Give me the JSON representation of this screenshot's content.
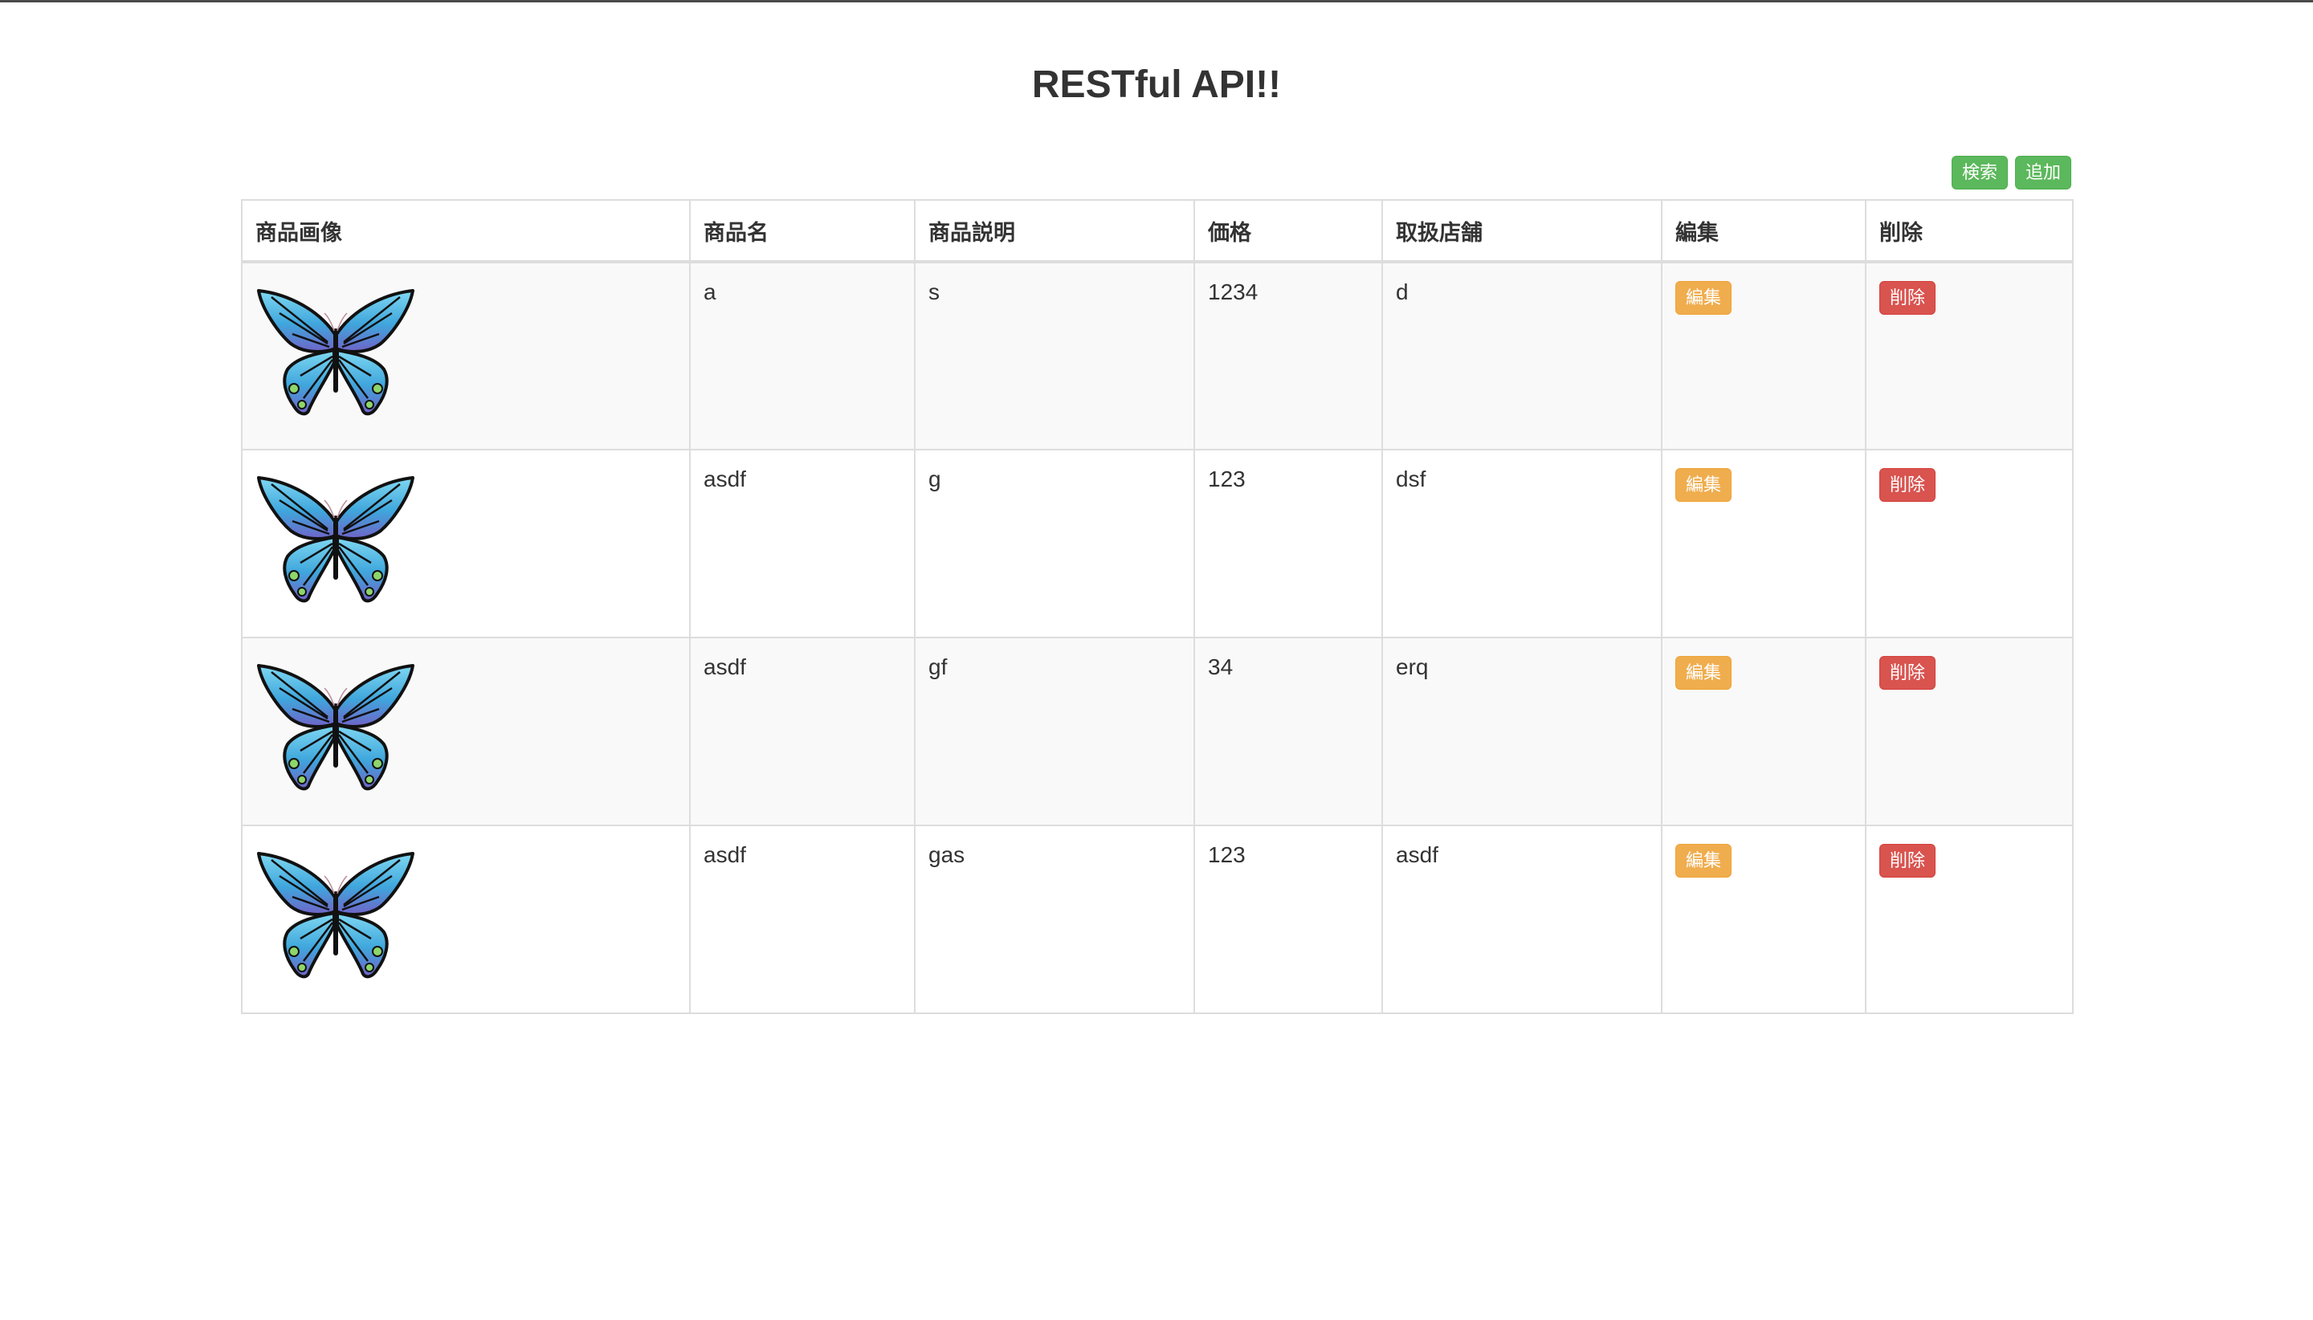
{
  "page": {
    "title": "RESTful API!!"
  },
  "toolbar": {
    "search_label": "検索",
    "add_label": "追加"
  },
  "table": {
    "headers": {
      "image": "商品画像",
      "name": "商品名",
      "description": "商品説明",
      "price": "価格",
      "store": "取扱店舗",
      "edit": "編集",
      "delete": "削除"
    },
    "rows": [
      {
        "name": "a",
        "description": "s",
        "price": "1234",
        "store": "d",
        "edit_label": "編集",
        "delete_label": "削除",
        "image_icon": "butterfly-icon"
      },
      {
        "name": "asdf",
        "description": "g",
        "price": "123",
        "store": "dsf",
        "edit_label": "編集",
        "delete_label": "削除",
        "image_icon": "butterfly-icon"
      },
      {
        "name": "asdf",
        "description": "gf",
        "price": "34",
        "store": "erq",
        "edit_label": "編集",
        "delete_label": "削除",
        "image_icon": "butterfly-icon"
      },
      {
        "name": "asdf",
        "description": "gas",
        "price": "123",
        "store": "asdf",
        "edit_label": "編集",
        "delete_label": "削除",
        "image_icon": "butterfly-icon"
      }
    ]
  },
  "colors": {
    "success": "#5cb85c",
    "warning": "#f0ad4e",
    "danger": "#d9534f",
    "border": "#dddddd",
    "stripe": "#f9f9f9"
  }
}
